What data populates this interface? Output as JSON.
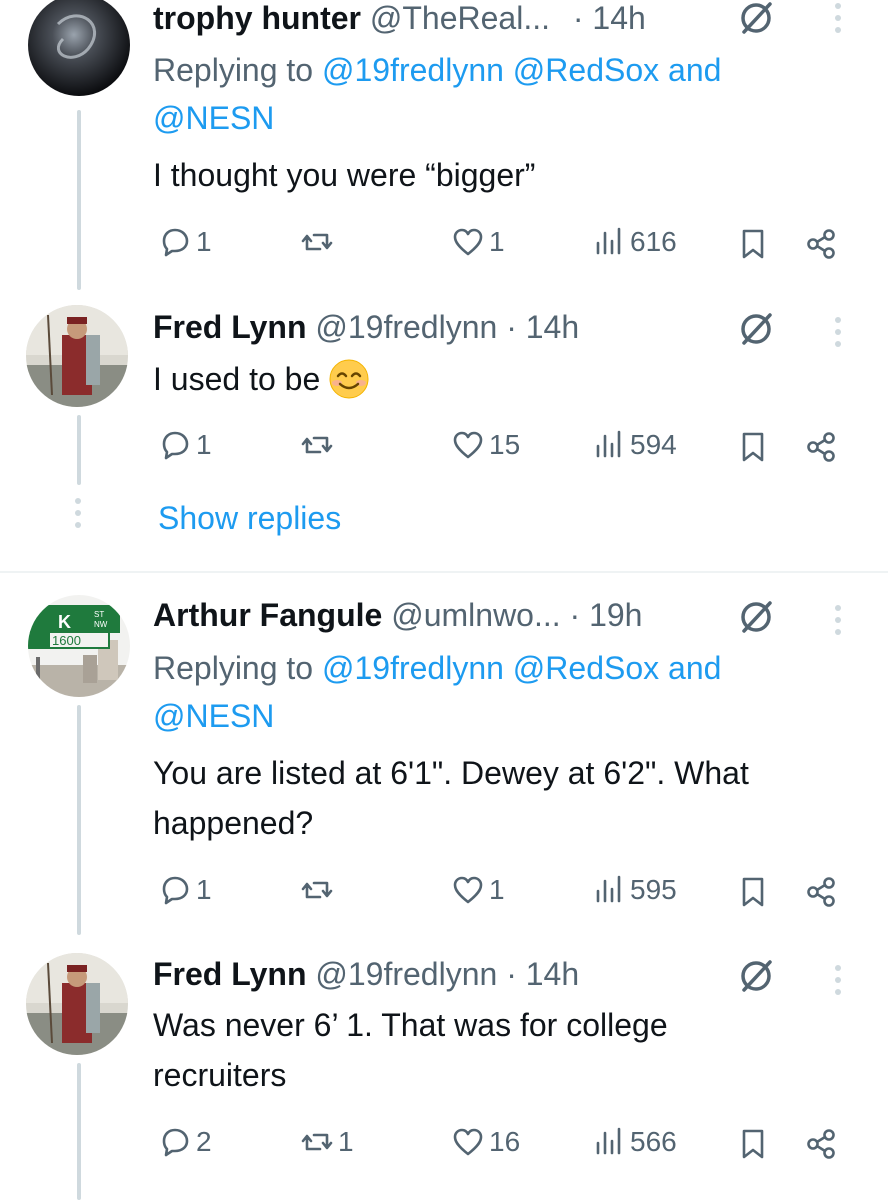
{
  "tweets": [
    {
      "name": "trophy hunter",
      "handle": "@TheReal...",
      "time": "· 14h",
      "replying_prefix": "Replying to ",
      "replying_to": "@19fredlynn @RedSox",
      "replying_and": " and",
      "replying_last": "@NESN",
      "text": "I thought you were “bigger”",
      "replies": "1",
      "reposts": "",
      "likes": "1",
      "views": "616"
    },
    {
      "name": "Fred Lynn",
      "handle": "@19fredlynn",
      "time": "· 14h",
      "text": "I used to be",
      "emoji": "smiling-face-icon",
      "replies": "1",
      "reposts": "",
      "likes": "15",
      "views": "594"
    },
    {
      "name": "Arthur Fangule",
      "handle": "@umlnwo...",
      "time": "· 19h",
      "replying_prefix": "Replying to ",
      "replying_to": "@19fredlynn @RedSox",
      "replying_and": " and",
      "replying_last": "@NESN",
      "text_line1": "You are listed at 6'1\". Dewey at 6'2\". What",
      "text_line2": "happened?",
      "replies": "1",
      "reposts": "",
      "likes": "1",
      "views": "595"
    },
    {
      "name": "Fred Lynn",
      "handle": "@19fredlynn",
      "time": "· 14h",
      "text_line1": "Was never 6’ 1. That was for college",
      "text_line2": "recruiters",
      "replies": "2",
      "reposts": "1",
      "likes": "16",
      "views": "566"
    }
  ],
  "show_replies": "Show replies",
  "avatar_sign": {
    "letter": "K",
    "st": "ST",
    "nw": "NW",
    "number": "1600"
  },
  "colors": {
    "accent": "#1d9bf0",
    "muted": "#536471",
    "text": "#0f1419",
    "line": "#cfd9de"
  }
}
